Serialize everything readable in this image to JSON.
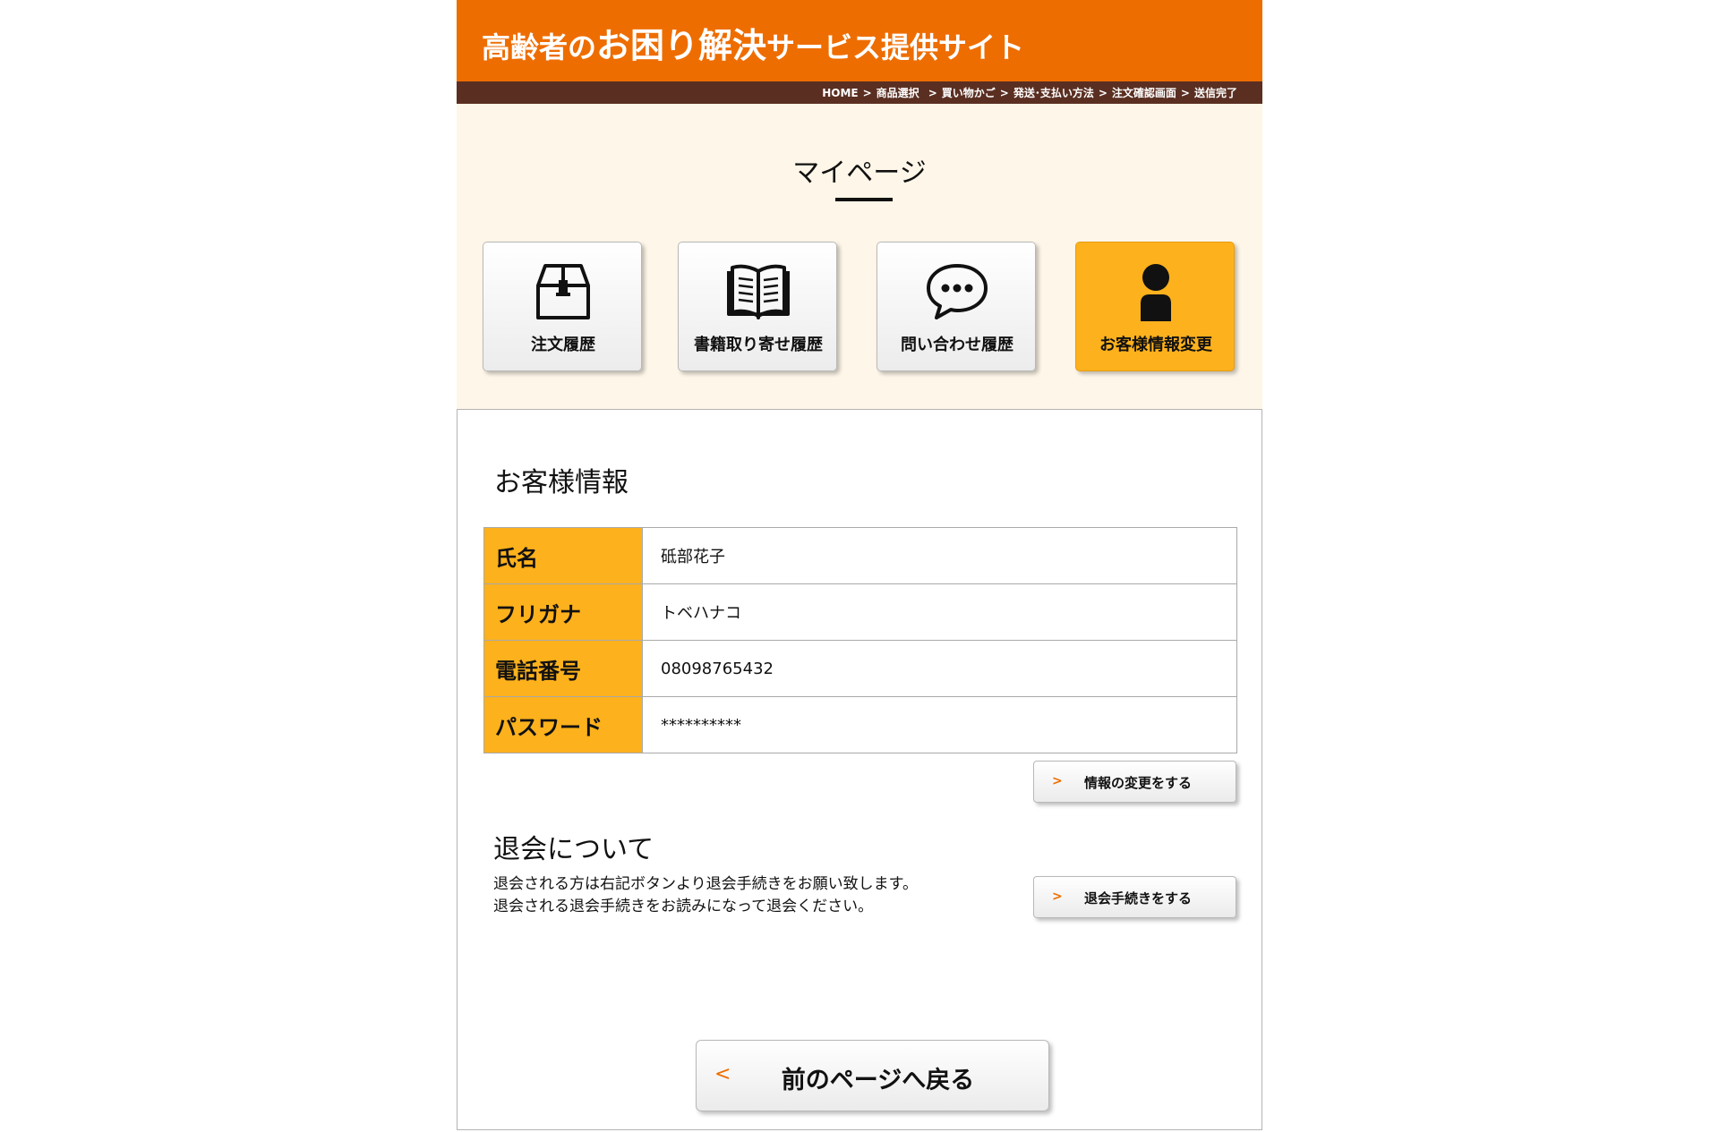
{
  "header": {
    "title_part1": "高齢者の",
    "title_part2": "お困り解決",
    "title_part3": "サービス提供サイト",
    "background_color": "#ee6d00"
  },
  "breadcrumb": {
    "items": [
      "HOME",
      "商品選択",
      "買い物かご",
      "発送･支払い方法",
      "注文確認画面",
      "送信完了"
    ],
    "separator": ">",
    "background_color": "#5a2f22"
  },
  "mypage": {
    "title": "マイページ",
    "menu": [
      {
        "label": "注文履歴",
        "icon": "box-icon",
        "active": false
      },
      {
        "label": "書籍取り寄せ履歴",
        "icon": "open-book-icon",
        "active": false
      },
      {
        "label": "問い合わせ履歴",
        "icon": "speech-bubble-icon",
        "active": false
      },
      {
        "label": "お客様情報変更",
        "icon": "person-icon",
        "active": true
      }
    ],
    "accent_color": "#fdb11c"
  },
  "customer_info": {
    "heading": "お客様情報",
    "rows": [
      {
        "label": "氏名",
        "value": "砥部花子"
      },
      {
        "label": "フリガナ",
        "value": "トベハナコ"
      },
      {
        "label": "電話番号",
        "value": "08098765432"
      },
      {
        "label": "パスワード",
        "value": "**********"
      }
    ],
    "change_button": "情報の変更をする"
  },
  "withdrawal": {
    "heading": "退会について",
    "line1": "退会される方は右記ボタンより退会手続きをお願い致します。",
    "line2": "退会される退会手続きをお読みになって退会ください。",
    "button": "退会手続きをする"
  },
  "back_button": {
    "chevron": "<",
    "label": "前のページへ戻る"
  },
  "chevron_right": ">"
}
